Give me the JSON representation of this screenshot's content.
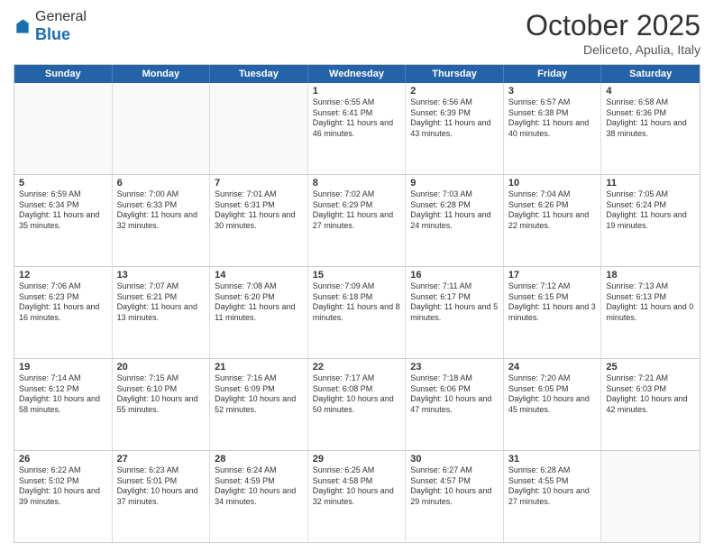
{
  "header": {
    "logo": {
      "general": "General",
      "blue": "Blue"
    },
    "title": "October 2025",
    "subtitle": "Deliceto, Apulia, Italy"
  },
  "calendar": {
    "day_names": [
      "Sunday",
      "Monday",
      "Tuesday",
      "Wednesday",
      "Thursday",
      "Friday",
      "Saturday"
    ],
    "rows": [
      [
        {
          "day": "",
          "empty": true
        },
        {
          "day": "",
          "empty": true
        },
        {
          "day": "",
          "empty": true
        },
        {
          "day": "1",
          "sunrise": "Sunrise: 6:55 AM",
          "sunset": "Sunset: 6:41 PM",
          "daylight": "Daylight: 11 hours and 46 minutes."
        },
        {
          "day": "2",
          "sunrise": "Sunrise: 6:56 AM",
          "sunset": "Sunset: 6:39 PM",
          "daylight": "Daylight: 11 hours and 43 minutes."
        },
        {
          "day": "3",
          "sunrise": "Sunrise: 6:57 AM",
          "sunset": "Sunset: 6:38 PM",
          "daylight": "Daylight: 11 hours and 40 minutes."
        },
        {
          "day": "4",
          "sunrise": "Sunrise: 6:58 AM",
          "sunset": "Sunset: 6:36 PM",
          "daylight": "Daylight: 11 hours and 38 minutes."
        }
      ],
      [
        {
          "day": "5",
          "sunrise": "Sunrise: 6:59 AM",
          "sunset": "Sunset: 6:34 PM",
          "daylight": "Daylight: 11 hours and 35 minutes."
        },
        {
          "day": "6",
          "sunrise": "Sunrise: 7:00 AM",
          "sunset": "Sunset: 6:33 PM",
          "daylight": "Daylight: 11 hours and 32 minutes."
        },
        {
          "day": "7",
          "sunrise": "Sunrise: 7:01 AM",
          "sunset": "Sunset: 6:31 PM",
          "daylight": "Daylight: 11 hours and 30 minutes."
        },
        {
          "day": "8",
          "sunrise": "Sunrise: 7:02 AM",
          "sunset": "Sunset: 6:29 PM",
          "daylight": "Daylight: 11 hours and 27 minutes."
        },
        {
          "day": "9",
          "sunrise": "Sunrise: 7:03 AM",
          "sunset": "Sunset: 6:28 PM",
          "daylight": "Daylight: 11 hours and 24 minutes."
        },
        {
          "day": "10",
          "sunrise": "Sunrise: 7:04 AM",
          "sunset": "Sunset: 6:26 PM",
          "daylight": "Daylight: 11 hours and 22 minutes."
        },
        {
          "day": "11",
          "sunrise": "Sunrise: 7:05 AM",
          "sunset": "Sunset: 6:24 PM",
          "daylight": "Daylight: 11 hours and 19 minutes."
        }
      ],
      [
        {
          "day": "12",
          "sunrise": "Sunrise: 7:06 AM",
          "sunset": "Sunset: 6:23 PM",
          "daylight": "Daylight: 11 hours and 16 minutes."
        },
        {
          "day": "13",
          "sunrise": "Sunrise: 7:07 AM",
          "sunset": "Sunset: 6:21 PM",
          "daylight": "Daylight: 11 hours and 13 minutes."
        },
        {
          "day": "14",
          "sunrise": "Sunrise: 7:08 AM",
          "sunset": "Sunset: 6:20 PM",
          "daylight": "Daylight: 11 hours and 11 minutes."
        },
        {
          "day": "15",
          "sunrise": "Sunrise: 7:09 AM",
          "sunset": "Sunset: 6:18 PM",
          "daylight": "Daylight: 11 hours and 8 minutes."
        },
        {
          "day": "16",
          "sunrise": "Sunrise: 7:11 AM",
          "sunset": "Sunset: 6:17 PM",
          "daylight": "Daylight: 11 hours and 5 minutes."
        },
        {
          "day": "17",
          "sunrise": "Sunrise: 7:12 AM",
          "sunset": "Sunset: 6:15 PM",
          "daylight": "Daylight: 11 hours and 3 minutes."
        },
        {
          "day": "18",
          "sunrise": "Sunrise: 7:13 AM",
          "sunset": "Sunset: 6:13 PM",
          "daylight": "Daylight: 11 hours and 0 minutes."
        }
      ],
      [
        {
          "day": "19",
          "sunrise": "Sunrise: 7:14 AM",
          "sunset": "Sunset: 6:12 PM",
          "daylight": "Daylight: 10 hours and 58 minutes."
        },
        {
          "day": "20",
          "sunrise": "Sunrise: 7:15 AM",
          "sunset": "Sunset: 6:10 PM",
          "daylight": "Daylight: 10 hours and 55 minutes."
        },
        {
          "day": "21",
          "sunrise": "Sunrise: 7:16 AM",
          "sunset": "Sunset: 6:09 PM",
          "daylight": "Daylight: 10 hours and 52 minutes."
        },
        {
          "day": "22",
          "sunrise": "Sunrise: 7:17 AM",
          "sunset": "Sunset: 6:08 PM",
          "daylight": "Daylight: 10 hours and 50 minutes."
        },
        {
          "day": "23",
          "sunrise": "Sunrise: 7:18 AM",
          "sunset": "Sunset: 6:06 PM",
          "daylight": "Daylight: 10 hours and 47 minutes."
        },
        {
          "day": "24",
          "sunrise": "Sunrise: 7:20 AM",
          "sunset": "Sunset: 6:05 PM",
          "daylight": "Daylight: 10 hours and 45 minutes."
        },
        {
          "day": "25",
          "sunrise": "Sunrise: 7:21 AM",
          "sunset": "Sunset: 6:03 PM",
          "daylight": "Daylight: 10 hours and 42 minutes."
        }
      ],
      [
        {
          "day": "26",
          "sunrise": "Sunrise: 6:22 AM",
          "sunset": "Sunset: 5:02 PM",
          "daylight": "Daylight: 10 hours and 39 minutes."
        },
        {
          "day": "27",
          "sunrise": "Sunrise: 6:23 AM",
          "sunset": "Sunset: 5:01 PM",
          "daylight": "Daylight: 10 hours and 37 minutes."
        },
        {
          "day": "28",
          "sunrise": "Sunrise: 6:24 AM",
          "sunset": "Sunset: 4:59 PM",
          "daylight": "Daylight: 10 hours and 34 minutes."
        },
        {
          "day": "29",
          "sunrise": "Sunrise: 6:25 AM",
          "sunset": "Sunset: 4:58 PM",
          "daylight": "Daylight: 10 hours and 32 minutes."
        },
        {
          "day": "30",
          "sunrise": "Sunrise: 6:27 AM",
          "sunset": "Sunset: 4:57 PM",
          "daylight": "Daylight: 10 hours and 29 minutes."
        },
        {
          "day": "31",
          "sunrise": "Sunrise: 6:28 AM",
          "sunset": "Sunset: 4:55 PM",
          "daylight": "Daylight: 10 hours and 27 minutes."
        },
        {
          "day": "",
          "empty": true
        }
      ]
    ]
  }
}
